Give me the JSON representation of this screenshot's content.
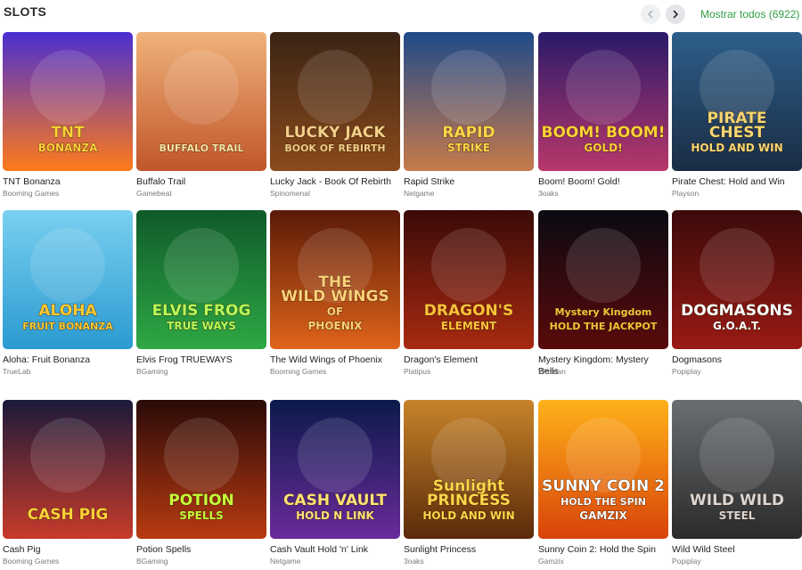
{
  "header": {
    "title": "SLOTS",
    "show_all": "Mostrar todos (6922)",
    "prev_icon": "chevron-left-icon",
    "next_icon": "chevron-right-icon"
  },
  "games": [
    {
      "name": "TNT Bonanza",
      "provider": "Booming Games",
      "logo": [
        "TNT",
        "BONANZA"
      ],
      "bg": [
        "#4a2fd0",
        "#ff7a1a"
      ],
      "logo_color": "#ffd23a"
    },
    {
      "name": "Buffalo Trail",
      "provider": "Gamebeat",
      "logo": [
        "BUFFALO TRAIL"
      ],
      "bg": [
        "#f0b27a",
        "#c1562a"
      ],
      "logo_color": "#ffe9a8"
    },
    {
      "name": "Lucky Jack - Book Of Rebirth",
      "provider": "Spinomenal",
      "logo": [
        "LUCKY JACK",
        "BOOK OF REBIRTH"
      ],
      "bg": [
        "#3a2414",
        "#8a4a1c"
      ],
      "logo_color": "#f3d08a"
    },
    {
      "name": "Rapid Strike",
      "provider": "Netgame",
      "logo": [
        "RAPID",
        "STRIKE"
      ],
      "bg": [
        "#1f4a8a",
        "#c77a4a"
      ],
      "logo_color": "#ffd84a"
    },
    {
      "name": "Boom! Boom! Gold!",
      "provider": "3oaks",
      "logo": [
        "BOOM! BOOM!",
        "GOLD!"
      ],
      "bg": [
        "#2a1a6a",
        "#b8376a"
      ],
      "logo_color": "#ffd23a"
    },
    {
      "name": "Pirate Chest: Hold and Win",
      "provider": "Playson",
      "logo": [
        "PIRATE",
        "CHEST",
        "HOLD AND WIN"
      ],
      "bg": [
        "#2d5f8a",
        "#1a2c44"
      ],
      "logo_color": "#f5d774"
    },
    {
      "name": "Aloha: Fruit Bonanza",
      "provider": "TrueLab",
      "logo": [
        "ALOHA",
        "FRUIT BONANZA"
      ],
      "bg": [
        "#7ad0f0",
        "#2a9ad0"
      ],
      "logo_color": "#ffcc33"
    },
    {
      "name": "Elvis Frog TRUEWAYS",
      "provider": "BGaming",
      "logo": [
        "ELVIS FROG",
        "TRUE WAYS"
      ],
      "bg": [
        "#0f5a2a",
        "#2ea844"
      ],
      "logo_color": "#b8ff5a"
    },
    {
      "name": "The Wild Wings of Phoenix",
      "provider": "Booming Games",
      "logo": [
        "THE",
        "WILD WINGS",
        "OF",
        "PHOENIX"
      ],
      "bg": [
        "#5a1a08",
        "#e0641a"
      ],
      "logo_color": "#ffd27a"
    },
    {
      "name": "Dragon's Element",
      "provider": "Platipus",
      "logo": [
        "DRAGON'S",
        "ELEMENT"
      ],
      "bg": [
        "#3a0a08",
        "#a82a10"
      ],
      "logo_color": "#ffc23a"
    },
    {
      "name": "Mystery Kingdom: Mystery Bells",
      "provider": "Wazdan",
      "logo": [
        "Mystery Kingdom",
        "HOLD THE JACKPOT"
      ],
      "bg": [
        "#0a0a12",
        "#5a0a0a"
      ],
      "logo_color": "#f2c23a"
    },
    {
      "name": "Dogmasons",
      "provider": "Popiplay",
      "logo": [
        "DOGMASONS",
        "G.O.A.T."
      ],
      "bg": [
        "#3a0a0a",
        "#9a1a14"
      ],
      "logo_color": "#ffffff"
    },
    {
      "name": "Cash Pig",
      "provider": "Booming Games",
      "logo": [
        "CASH PIG"
      ],
      "bg": [
        "#1a1a3a",
        "#c83a2a"
      ],
      "logo_color": "#ffd23a"
    },
    {
      "name": "Potion Spells",
      "provider": "BGaming",
      "logo": [
        "POTION",
        "SPELLS"
      ],
      "bg": [
        "#2a0a08",
        "#b83a10"
      ],
      "logo_color": "#c8ff3a"
    },
    {
      "name": "Cash Vault Hold 'n' Link",
      "provider": "Netgame",
      "logo": [
        "CASH VAULT",
        "HOLD N LINK"
      ],
      "bg": [
        "#0a1a4a",
        "#6a2a9a"
      ],
      "logo_color": "#ffe27a"
    },
    {
      "name": "Sunlight Princess",
      "provider": "3oaks",
      "logo": [
        "Sunlight",
        "PRINCESS",
        "HOLD AND WIN"
      ],
      "bg": [
        "#c8842a",
        "#5a2a0a"
      ],
      "logo_color": "#ffd84a"
    },
    {
      "name": "Sunny Coin 2: Hold the Spin",
      "provider": "Gamzix",
      "logo": [
        "SUNNY COIN 2",
        "HOLD THE SPIN",
        "GAMZIX"
      ],
      "bg": [
        "#ffb21a",
        "#d8420a"
      ],
      "logo_color": "#ffffff"
    },
    {
      "name": "Wild Wild Steel",
      "provider": "Popiplay",
      "logo": [
        "WILD WILD",
        "STEEL"
      ],
      "bg": [
        "#6a6e72",
        "#2a2a2a"
      ],
      "logo_color": "#d8d8d8"
    }
  ]
}
